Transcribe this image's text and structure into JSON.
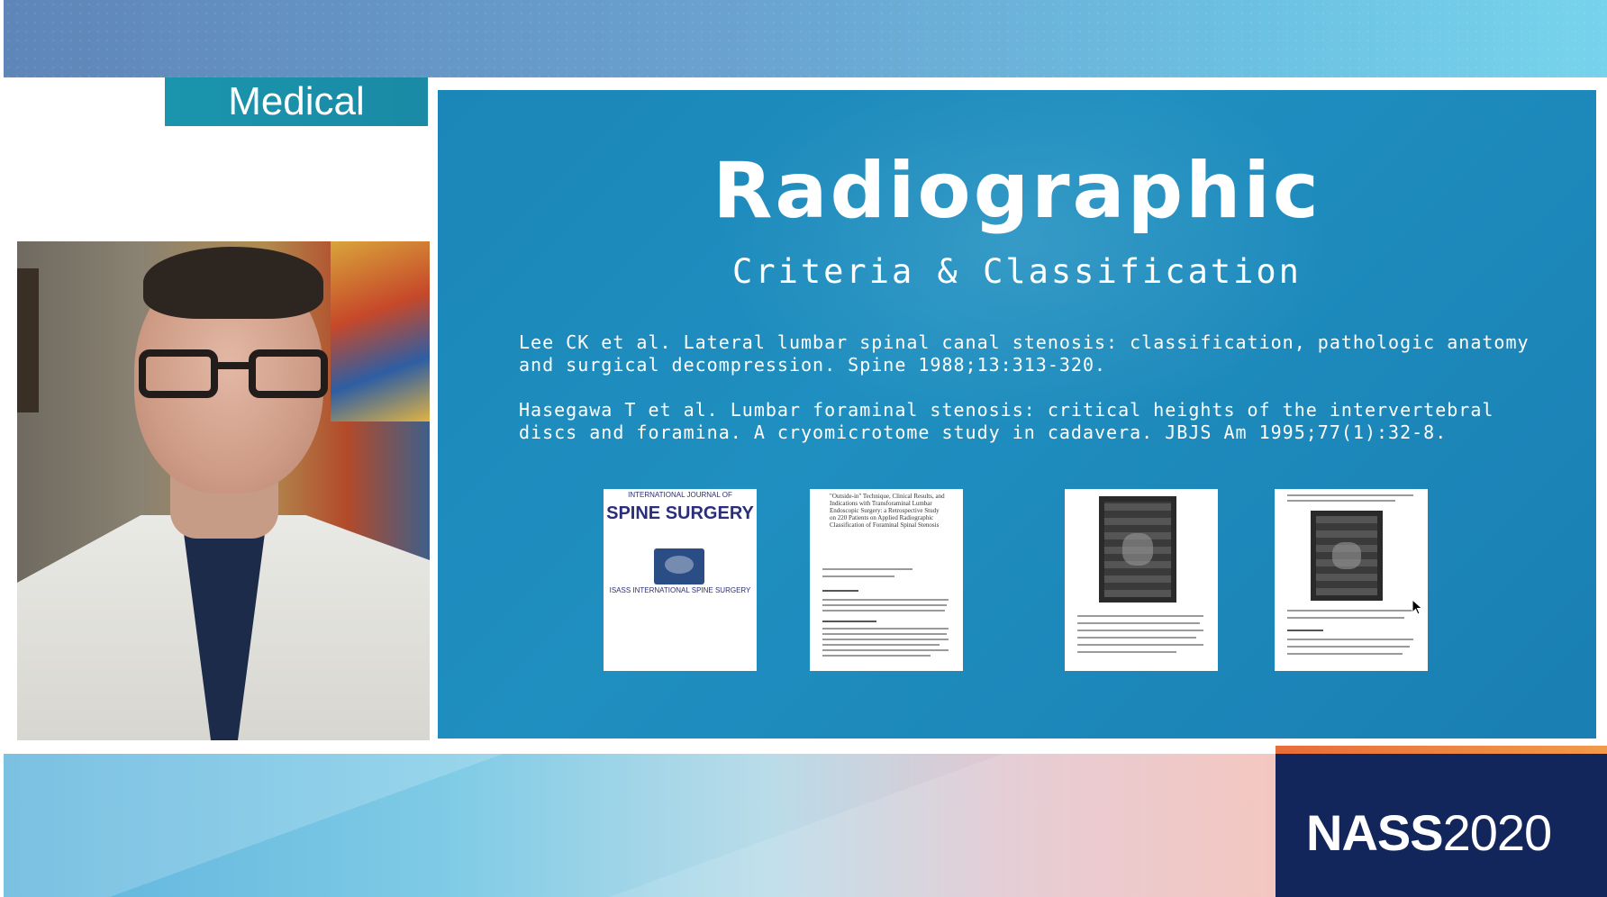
{
  "header": {
    "category_label": "Medical"
  },
  "slide": {
    "title": "Radiographic",
    "subtitle": "Criteria & Classification",
    "references": [
      "Lee CK et al. Lateral lumbar spinal canal stenosis: classification, pathologic anatomy and surgical decompression. Spine 1988;13:313-320.",
      "Hasegawa T et al. Lumbar foraminal stenosis: critical heights of the intervertebral discs and foramina. A cryomicrotome study in cadavera. JBJS Am 1995;77(1):32-8."
    ],
    "thumbnails": {
      "journal_cover": {
        "masthead": "INTERNATIONAL JOURNAL OF",
        "title": "SPINE SURGERY",
        "logo_caption": "ISASS INTERNATIONAL SPINE SURGERY"
      },
      "article_title": "\"Outside-in\" Technique, Clinical Results, and Indications with Transforaminal Lumbar Endoscopic Surgery: a Retrospective Study on 220 Patients on Applied Radiographic Classification of Foraminal Spinal Stenosis"
    }
  },
  "footer": {
    "brand_bold": "NASS",
    "brand_year": "2020"
  },
  "colors": {
    "slide_background": "#1f8fc0",
    "category_badge": "#1a90a9",
    "brand_box": "#13265c",
    "brand_accent": "#f08a45"
  },
  "icons": {
    "cursor": "mouse-pointer-icon"
  }
}
